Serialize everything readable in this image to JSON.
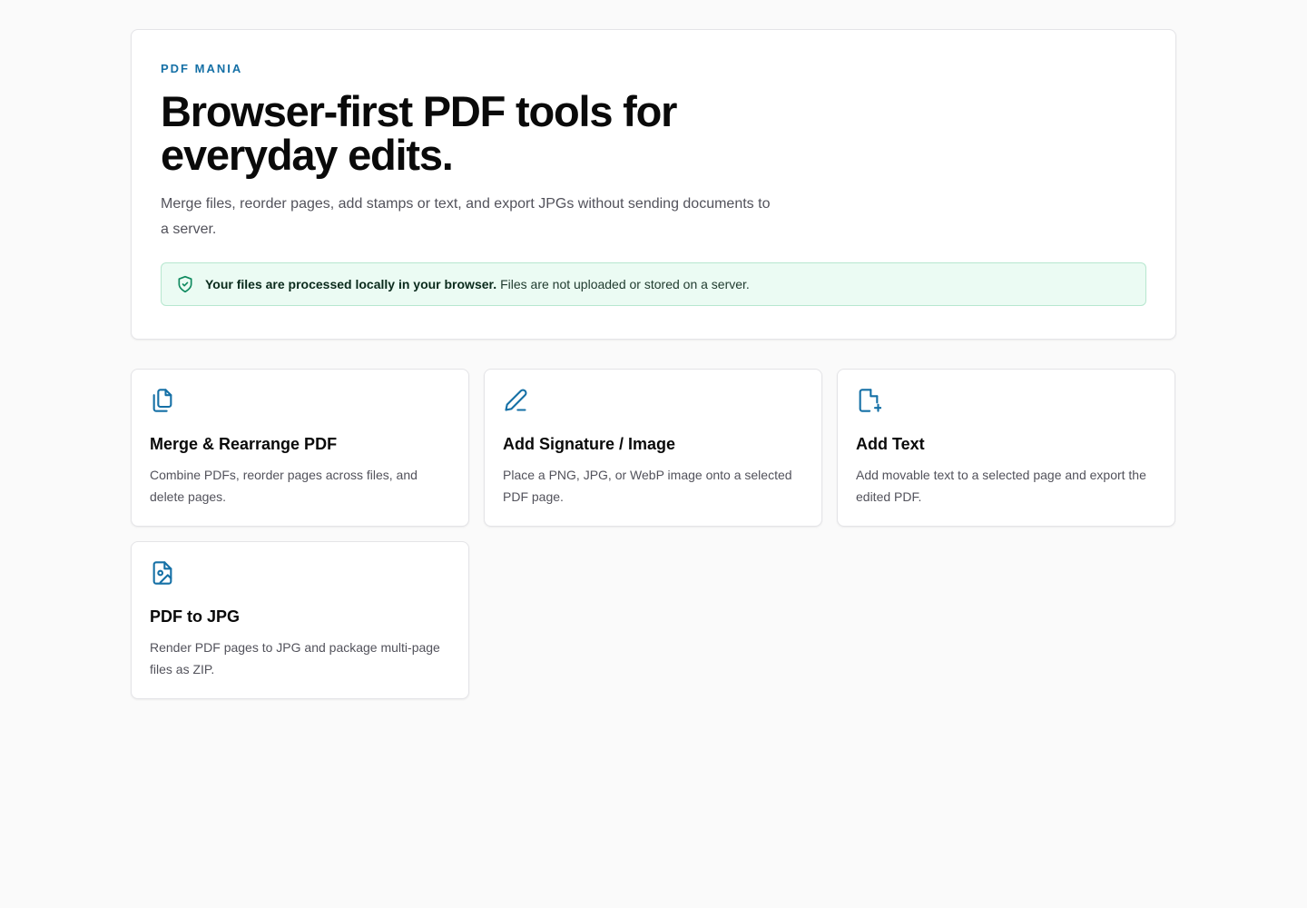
{
  "hero": {
    "brand": "PDF MANIA",
    "headline": "Browser-first PDF tools for everyday edits.",
    "subtitle": "Merge files, reorder pages, add stamps or text, and export JPGs without sending documents to a server.",
    "notice": {
      "icon": "shield-check-icon",
      "bold": "Your files are processed locally in your browser.",
      "text": "Files are not uploaded or stored on a server."
    }
  },
  "tools": [
    {
      "icon": "files-icon",
      "title": "Merge & Rearrange PDF",
      "description": "Combine PDFs, reorder pages across files, and delete pages."
    },
    {
      "icon": "pen-icon",
      "title": "Add Signature / Image",
      "description": "Place a PNG, JPG, or WebP image onto a selected PDF page."
    },
    {
      "icon": "file-plus-icon",
      "title": "Add Text",
      "description": "Add movable text to a selected page and export the edited PDF."
    },
    {
      "icon": "file-image-icon",
      "title": "PDF to JPG",
      "description": "Render PDF pages to JPG and package multi-page files as ZIP."
    }
  ],
  "colors": {
    "accent": "#1570a6",
    "notice_bg": "#ebfbf3",
    "notice_border": "#b7e7cf",
    "shield": "#0f8a5f"
  }
}
